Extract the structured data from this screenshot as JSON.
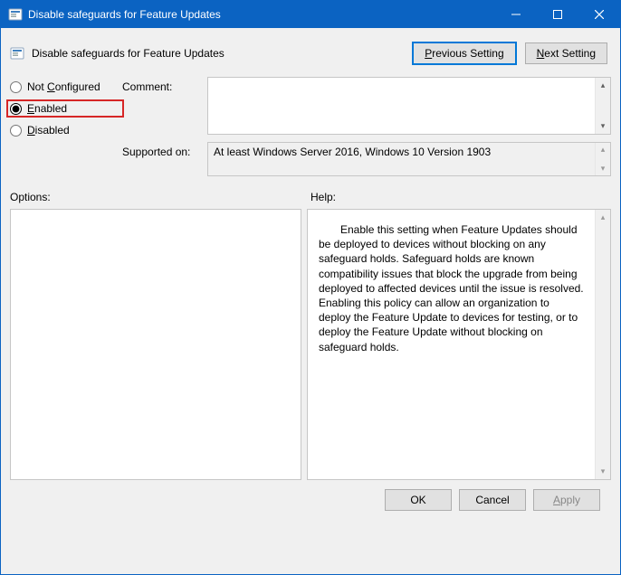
{
  "window": {
    "title": "Disable safeguards for Feature Updates"
  },
  "header": {
    "policy_name": "Disable safeguards for Feature Updates"
  },
  "nav": {
    "previous": "Previous Setting",
    "next": "Next Setting",
    "previous_u": "P",
    "next_u": "N"
  },
  "state": {
    "options": [
      {
        "key": "not_configured",
        "label": "Not Configured",
        "u": "C",
        "checked": false,
        "highlight": false
      },
      {
        "key": "enabled",
        "label": "Enabled",
        "u": "E",
        "checked": true,
        "highlight": true
      },
      {
        "key": "disabled",
        "label": "Disabled",
        "u": "D",
        "checked": false,
        "highlight": false
      }
    ]
  },
  "labels": {
    "comment": "Comment:",
    "supported_on": "Supported on:",
    "options": "Options:",
    "help": "Help:"
  },
  "comment": {
    "value": ""
  },
  "supported_on": {
    "value": "At least Windows Server 2016, Windows 10 Version 1903"
  },
  "help": {
    "text": "Enable this setting when Feature Updates should be deployed to devices without blocking on any safeguard holds. Safeguard holds are known compatibility issues that block the upgrade from being deployed to affected devices until the issue is resolved. Enabling this policy can allow an organization to deploy the Feature Update to devices for testing, or to deploy the Feature Update without blocking on safeguard holds."
  },
  "footer": {
    "ok": "OK",
    "cancel": "Cancel",
    "apply": "Apply",
    "apply_u": "A"
  }
}
